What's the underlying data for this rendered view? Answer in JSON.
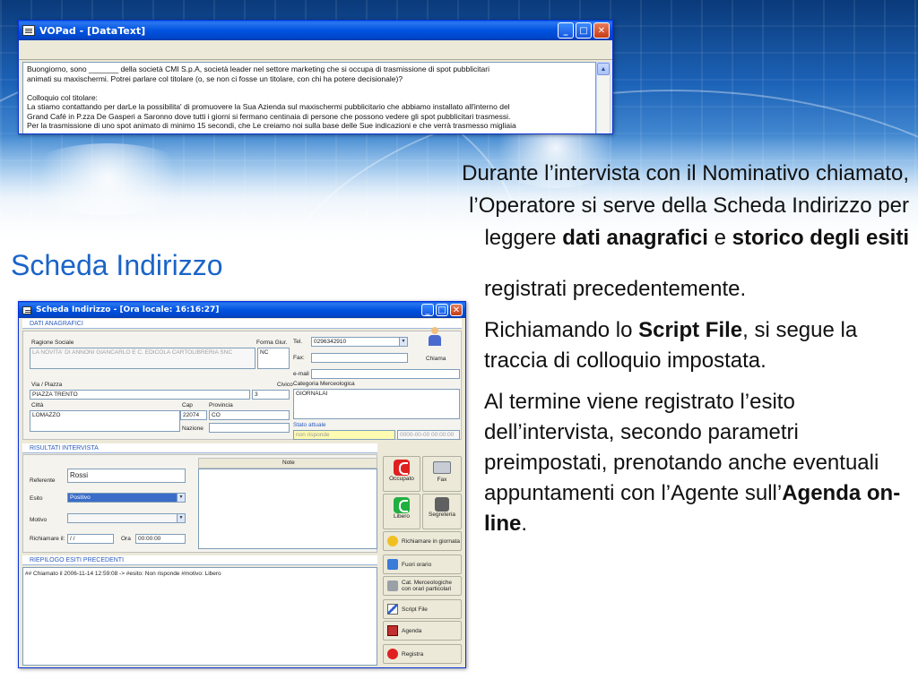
{
  "vopad": {
    "title": "VOPad - [DataText]",
    "lines": [
      "Buongiorno, sono _______ della società CMI S.p.A, società leader nel settore marketing che si occupa di trasmissione di spot pubblicitari",
      "animati su maxischermi. Potrei parlare col titolare (o, se non ci fosse un titolare, con chi ha potere decisionale)?",
      "",
      "Colloquio col titolare:",
      "La stiamo contattando per darLe la possibilita' di promuovere la Sua Azienda sul maxischermi pubblicitario che abbiamo installato all'interno del",
      "Grand Café in P.zza De Gasperi a Saronno dove tutti i giorni si fermano centinaia di persone che possono vedere gli spot pubblicitari trasmessi.",
      "Per la trasmissione di uno spot animato di minimo 15 secondi, che Le creiamo noi sulla base delle Sue indicazioni e che verrà trasmesso migliaia"
    ]
  },
  "slide": {
    "heading": "Scheda Indirizzo",
    "intro": {
      "line1": "Durante l’intervista con il Nominativo chiamato,",
      "line2": "l’Operatore si serve della Scheda Indirizzo per",
      "line3_pre": "leggere ",
      "line3_b1": "dati anagrafici",
      "line3_mid": " e ",
      "line3_b2": "storico degli esiti"
    },
    "p1": "registrati precedentemente.",
    "p2_pre": "Richiamando lo ",
    "p2_b": "Script File",
    "p2_post": ", si segue la traccia di colloquio impostata.",
    "p3_pre": "Al termine viene registrato l’esito dell’intervista, secondo parametri preimpostati, prenotando anche eventuali appuntamenti con l’Agente sull’",
    "p3_b": "Agenda on-line",
    "p3_post": "."
  },
  "scheda": {
    "title": "Scheda Indirizzo  - [Ora locale: 16:16:27]",
    "dati": {
      "header": "DATI ANAGRAFICI",
      "ragione_label": "Ragione Sociale",
      "ragione_value": "LA NOVITA' DI ANNONI GIANCARLO E C. EDICOLA CARTOLIBRERIA SNC",
      "forma_label": "Forma Giur.",
      "forma_value": "NC",
      "via_label": "Via / Piazza",
      "via_value": "PIAZZA TRENTO",
      "civico_label": "Civico",
      "civico_value": "3",
      "citta_label": "Città",
      "citta_value": "LOMAZZO",
      "cap_label": "Cap",
      "cap_value": "22074",
      "prov_label": "Provincia",
      "prov_value": "CO",
      "nazione_label": "Nazione",
      "tel_label": "Tel.",
      "tel_value": "0296342910",
      "fax_label": "Fax:",
      "email_label": "e-mail",
      "chiama_label": "Chiama",
      "categoria_label": "Categoria Merceologica",
      "categoria_value": "GIORNALAI",
      "stato_label": "Stato attuale",
      "stato_value": "non risponde",
      "stato_date": "0000-00-00 00:00:00"
    },
    "risultati": {
      "header": "RISULTATI INTERVISTA",
      "referente_label": "Referente",
      "referente_value": "Rossi",
      "esito_label": "Esito",
      "esito_value": "Positivo",
      "motivo_label": "Motivo",
      "richiamare_label": "Richiamare il:",
      "richiamare_value": " / /",
      "ora_label": "Ora",
      "ora_value": "00:00:00",
      "note_label": "Note"
    },
    "buttons": {
      "occupato": "Occupato",
      "fax": "Fax",
      "libero": "Libero",
      "segreteria": "Segreteria",
      "richiamare_giornata": "Richiamare in giornata",
      "fuori_orario": "Fuori orario",
      "cat_merceologiche": "Cat. Merceologiche con orari particolari",
      "script_file": "Script File",
      "agenda": "Agenda",
      "registra": "Registra"
    },
    "riepilogo": {
      "header": "RIEPILOGO ESITI PRECEDENTI",
      "entry": "## Chiamato il 2006-11-14 12:59:08 -> #esito: Non risponde  #motivo: Libero"
    }
  }
}
